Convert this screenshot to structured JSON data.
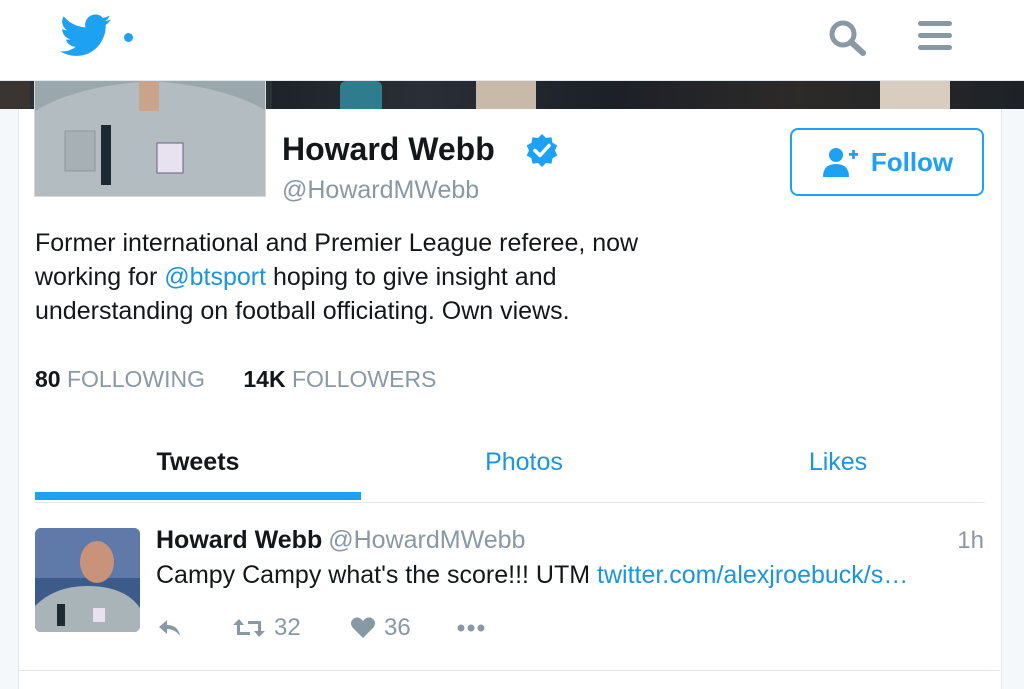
{
  "header": {
    "logo_icon": "twitter-bird-icon",
    "search_icon": "search-icon",
    "menu_icon": "hamburger-menu-icon",
    "brand_color": "#1da1f2"
  },
  "profile": {
    "name": "Howard Webb",
    "verified_icon": "verified-badge-icon",
    "handle": "@HowardMWebb",
    "follow_label": "Follow",
    "bio_part1": "Former international and Premier League referee, now working for ",
    "bio_mention": "@btsport",
    "bio_part2": " hoping to give insight and understanding on football officiating. Own views.",
    "stats": {
      "following_count": "80",
      "following_label": "FOLLOWING",
      "followers_count": "14K",
      "followers_label": "FOLLOWERS"
    }
  },
  "tabs": [
    {
      "label": "Tweets",
      "active": true
    },
    {
      "label": "Photos",
      "active": false
    },
    {
      "label": "Likes",
      "active": false
    }
  ],
  "tweet": {
    "name": "Howard Webb",
    "handle": "@HowardMWebb",
    "time": "1h",
    "text": "Campy Campy what's the score!!! UTM ",
    "link": "twitter.com/alexjroebuck/s…",
    "retweets": "32",
    "likes": "36"
  }
}
